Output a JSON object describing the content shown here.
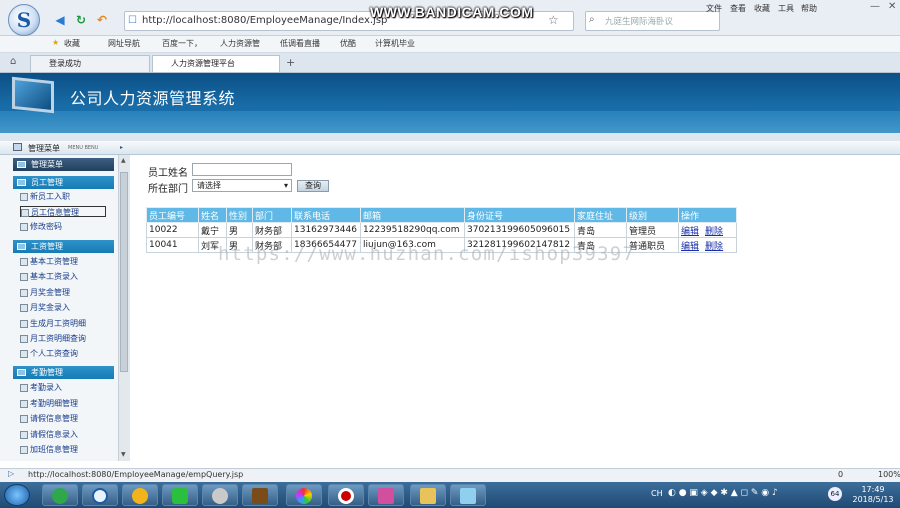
{
  "browser": {
    "url": "http://localhost:8080/EmployeeManage/Index.jsp",
    "search_placeholder": "九庭生网际海卧议",
    "watermark_top": "WWW.BANDICAM.COM",
    "menu": [
      "文件",
      "查看",
      "收藏",
      "工具",
      "帮助"
    ],
    "favorites": [
      "收藏",
      "网址导航",
      "百度一下，",
      "人力资源管",
      "低调看直播",
      "优酷",
      "计算机毕业"
    ],
    "tabs": [
      "登录成功",
      "人力资源管理平台"
    ],
    "tab_add": "+"
  },
  "app": {
    "title": "公司人力资源管理系统",
    "menu_header": "管理菜单",
    "menu_header_sub": "MENU BENU",
    "sidebar": {
      "top_label": "管理菜单",
      "sections": [
        {
          "label": "员工管理",
          "items": [
            "新员工入职",
            "员工信息管理",
            "修改密码"
          ]
        },
        {
          "label": "工资管理",
          "items": [
            "基本工资管理",
            "基本工资录入",
            "月奖金管理",
            "月奖金录入",
            "生成月工资明细",
            "月工资明细查询",
            "个人工资查询"
          ]
        },
        {
          "label": "考勤管理",
          "items": [
            "考勤录入",
            "考勤明细管理",
            "请假信息管理",
            "请假信息录入",
            "加班信息管理"
          ]
        }
      ]
    },
    "form": {
      "name_label": "员工姓名",
      "name_value": "",
      "dept_label": "所在部门",
      "dept_value": "请选择",
      "query_button": "查询"
    },
    "table": {
      "headers": [
        "员工编号",
        "姓名",
        "性别",
        "部门",
        "联系电话",
        "邮箱",
        "身份证号",
        "家庭住址",
        "级别",
        "操作"
      ],
      "rows": [
        [
          "10022",
          "戴宁",
          "男",
          "财务部",
          "13162973446",
          "12239518290qq.com",
          "370213199605096015",
          "青岛",
          "管理员"
        ],
        [
          "10041",
          "刘军",
          "男",
          "财务部",
          "18366654477",
          "liujun@163.com",
          "321281199602147812",
          "青岛",
          "普通职员"
        ]
      ],
      "action_edit": "编辑",
      "action_delete": "删除"
    },
    "watermark": "https://www.huzhan.com/ishop39397"
  },
  "status": {
    "url": "http://localhost:8080/EmployeeManage/empQuery.jsp",
    "zoom": "100%",
    "count": "0"
  },
  "taskbar": {
    "lang": "CH",
    "date": "2018/5/13",
    "time": "17:49",
    "badge": "64"
  }
}
